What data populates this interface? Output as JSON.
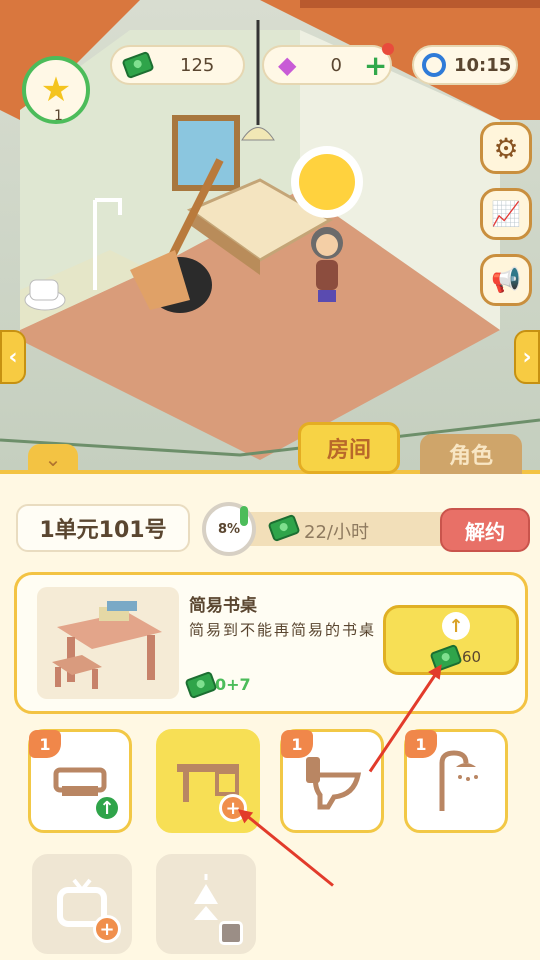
{
  "hud": {
    "level": "1",
    "cash": "125",
    "gems": "0",
    "clock": "10:15"
  },
  "side_buttons": {
    "settings_icon": "gear-icon",
    "stats_icon": "chart-icon",
    "announce_icon": "megaphone-icon"
  },
  "tabs": {
    "room": "房间",
    "character": "角色"
  },
  "room_info": {
    "name": "1单元101号",
    "progress": "8%",
    "progress_value": 0.08,
    "income": "22/小时",
    "unlock_label": "解约"
  },
  "item": {
    "title": "简易书桌",
    "description": "简易到不能再简易的书桌",
    "bonus": "0+7",
    "upgrade_cost": "60"
  },
  "furniture": [
    {
      "badge": "1",
      "icon": "bed-icon"
    },
    {
      "badge": "",
      "icon": "desk-icon"
    },
    {
      "badge": "1",
      "icon": "toilet-icon"
    },
    {
      "badge": "1",
      "icon": "shower-icon"
    },
    {
      "badge": "",
      "icon": "tv-icon"
    },
    {
      "badge": "",
      "icon": "lamp-icon"
    }
  ],
  "colors": {
    "accent_yellow": "#f3c343",
    "cash_green": "#2fa44a",
    "unlock_red": "#e87067",
    "annotation_red": "#e23b2b"
  }
}
